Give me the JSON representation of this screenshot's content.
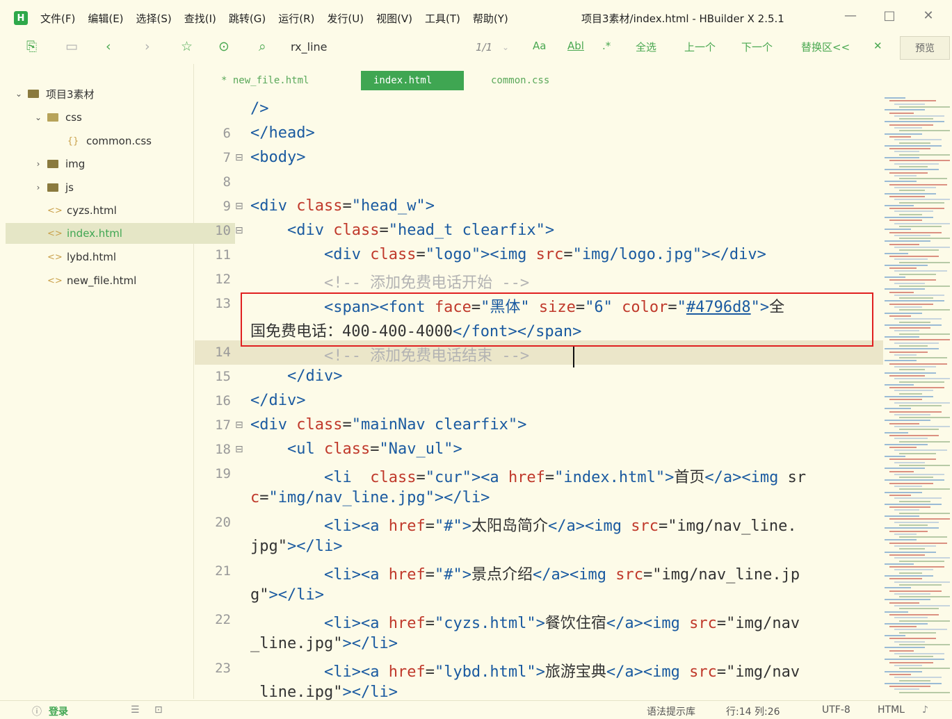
{
  "app": {
    "logo": "H",
    "window_title": "项目3素材/index.html - HBuilder X 2.5.1"
  },
  "menu": [
    "文件(F)",
    "编辑(E)",
    "选择(S)",
    "查找(I)",
    "跳转(G)",
    "运行(R)",
    "发行(U)",
    "视图(V)",
    "工具(T)",
    "帮助(Y)"
  ],
  "window_controls": {
    "minimize": "—",
    "maximize": "□",
    "close": "✕"
  },
  "toolbar": {
    "find_text": "rx_line",
    "match_counter": "1/1",
    "case_toggle": "Aa",
    "word_toggle": "Abl",
    "regex_toggle": ".*",
    "select_all": "全选",
    "prev": "上一个",
    "next": "下一个",
    "replace": "替换区<<",
    "close_find": "✕",
    "preview": "预览"
  },
  "sidebar": {
    "items": [
      {
        "label": "项目3素材",
        "type": "folder",
        "level": 0,
        "expanded": true
      },
      {
        "label": "css",
        "type": "folder",
        "level": 1,
        "expanded": true
      },
      {
        "label": "common.css",
        "type": "css",
        "level": 2
      },
      {
        "label": "img",
        "type": "folder",
        "level": 1,
        "expanded": false
      },
      {
        "label": "js",
        "type": "folder",
        "level": 1,
        "expanded": false
      },
      {
        "label": "cyzs.html",
        "type": "html",
        "level": 1
      },
      {
        "label": "index.html",
        "type": "html",
        "level": 1,
        "active": true
      },
      {
        "label": "lybd.html",
        "type": "html",
        "level": 1
      },
      {
        "label": "new_file.html",
        "type": "html",
        "level": 1
      }
    ]
  },
  "tabs": [
    {
      "label": "* new_file.html",
      "active": false
    },
    {
      "label": "index.html",
      "active": true
    },
    {
      "label": "common.css",
      "active": false
    }
  ],
  "code_lines": [
    {
      "num": "",
      "fold": "",
      "text": "/>"
    },
    {
      "num": "6",
      "fold": "",
      "text": "</head>"
    },
    {
      "num": "7",
      "fold": "⊟",
      "text": "<body>"
    },
    {
      "num": "8",
      "fold": "",
      "text": ""
    },
    {
      "num": "9",
      "fold": "⊟",
      "text": "<div class=\"head_w\">"
    },
    {
      "num": "10",
      "fold": "⊟",
      "text": "    <div class=\"head_t clearfix\">"
    },
    {
      "num": "11",
      "fold": "",
      "text": "        <div class=\"logo\"><img src=\"img/logo.jpg\"></div>"
    },
    {
      "num": "12",
      "fold": "",
      "text": "        <!-- 添加免费电话开始 -->"
    },
    {
      "num": "13",
      "fold": "",
      "text": "        <span><font face=\"黑体\" size=\"6\" color=\"#4796d8\">全"
    },
    {
      "num": "",
      "fold": "",
      "text": "国免费电话：400-400-4000</font></span>"
    },
    {
      "num": "14",
      "fold": "",
      "text": "        <!-- 添加免费电话结束 -->"
    },
    {
      "num": "15",
      "fold": "",
      "text": "    </div>"
    },
    {
      "num": "16",
      "fold": "",
      "text": "</div>"
    },
    {
      "num": "17",
      "fold": "⊟",
      "text": "<div class=\"mainNav clearfix\">"
    },
    {
      "num": "18",
      "fold": "⊟",
      "text": "    <ul class=\"Nav_ul\">"
    },
    {
      "num": "19",
      "fold": "",
      "text": "        <li  class=\"cur\"><a href=\"index.html\">首页</a><img sr"
    },
    {
      "num": "",
      "fold": "",
      "text": "c=\"img/nav_line.jpg\"></li>"
    },
    {
      "num": "20",
      "fold": "",
      "text": "        <li><a href=\"#\">太阳岛简介</a><img src=\"img/nav_line."
    },
    {
      "num": "",
      "fold": "",
      "text": "jpg\"></li>"
    },
    {
      "num": "21",
      "fold": "",
      "text": "        <li><a href=\"#\">景点介绍</a><img src=\"img/nav_line.jp"
    },
    {
      "num": "",
      "fold": "",
      "text": "g\"></li>"
    },
    {
      "num": "22",
      "fold": "",
      "text": "        <li><a href=\"cyzs.html\">餐饮住宿</a><img src=\"img/nav"
    },
    {
      "num": "",
      "fold": "",
      "text": "_line.jpg\"></li>"
    },
    {
      "num": "23",
      "fold": "",
      "text": "        <li><a href=\"lybd.html\">旅游宝典</a><img src=\"img/nav"
    },
    {
      "num": "",
      "fold": "",
      "text": " line.ipg\"></li>"
    }
  ],
  "statusbar": {
    "login": "登录",
    "hint": "语法提示库",
    "position": "行:14  列:26",
    "encoding": "UTF-8",
    "lang": "HTML"
  },
  "colors": {
    "background": "#fdfbe8",
    "accent": "#3fa652",
    "tag": "#1a5aa0",
    "attr": "#c0392b",
    "highlight_box": "#e02020"
  }
}
